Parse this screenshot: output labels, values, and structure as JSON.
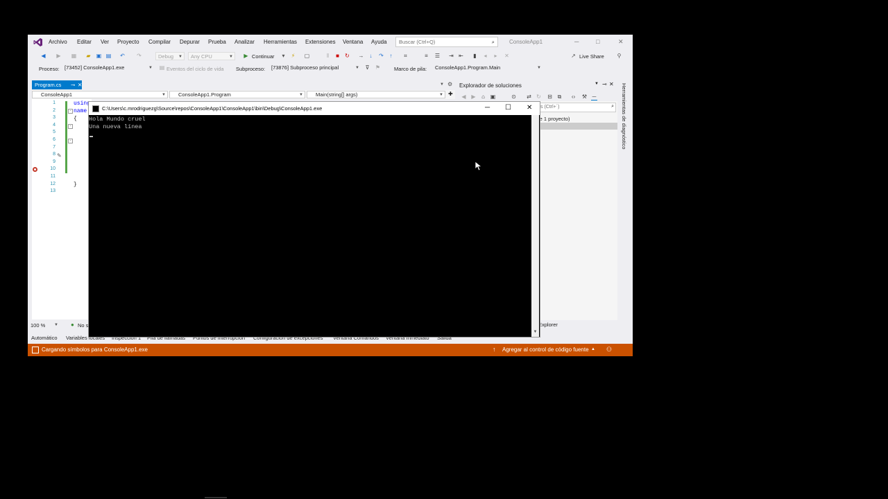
{
  "menu": {
    "items": [
      "Archivo",
      "Editar",
      "Ver",
      "Proyecto",
      "Compilar",
      "Depurar",
      "Prueba",
      "Analizar",
      "Herramientas",
      "Extensiones",
      "Ventana",
      "Ayuda"
    ],
    "search_placeholder": "Buscar (Ctrl+Q)",
    "solution_name": "ConsoleApp1",
    "live_share": "Live Share"
  },
  "toolbar": {
    "config": "Debug",
    "platform": "Any CPU",
    "continue": "Continuar"
  },
  "debug_bar": {
    "process_label": "Proceso:",
    "process_value": "[73452] ConsoleApp1.exe",
    "lifecycle_events": "Eventos del ciclo de vida",
    "thread_label": "Subproceso:",
    "thread_value": "[73876] Subproceso principal",
    "stack_label": "Marco de pila:",
    "stack_value": "ConsoleApp1.Program.Main"
  },
  "editor": {
    "tab_label": "Program.cs",
    "nav_project": "ConsoleApp1",
    "nav_class": "ConsoleApp1.Program",
    "nav_member": "Main(string[] args)",
    "line_numbers": [
      "1",
      "2",
      "3",
      "4",
      "5",
      "6",
      "7",
      "8",
      "9",
      "10",
      "11",
      "12",
      "13"
    ],
    "code_line1": "using",
    "code_line2": "name",
    "code_line3": "{",
    "code_line12": "}",
    "zoom": "100 %",
    "issues": "No s"
  },
  "solution_explorer": {
    "title": "Explorador de soluciones",
    "search_placeholder": "s (Ctrl+´)",
    "item": "le 1 proyecto)",
    "bottom_tab": "Explorer"
  },
  "side_panel": {
    "diagnostics": "Herramientas de diagnóstico"
  },
  "bottom_tabs": [
    "Automático",
    "Variables locales",
    "Inspección 1",
    "Pila de llamadas",
    "Puntos de interrupción",
    "Configuración de excepciones",
    "Ventana Comandos",
    "Ventana Inmediato",
    "Salida"
  ],
  "statusbar": {
    "left": "Cargando símbolos para ConsoleApp1.exe",
    "right": "Agregar al control de código fuente"
  },
  "console": {
    "title": "C:\\Users\\c.mrodriguezg\\Source\\repos\\ConsoleApp1\\ConsoleApp1\\bin\\Debug\\ConsoleApp1.exe",
    "output": "Hola Mundo cruel\nUna nueva línea"
  },
  "colors": {
    "accent": "#007acc",
    "status_bar": "#ca5100",
    "console_bg": "#000000",
    "console_text": "#c0c0c0"
  }
}
